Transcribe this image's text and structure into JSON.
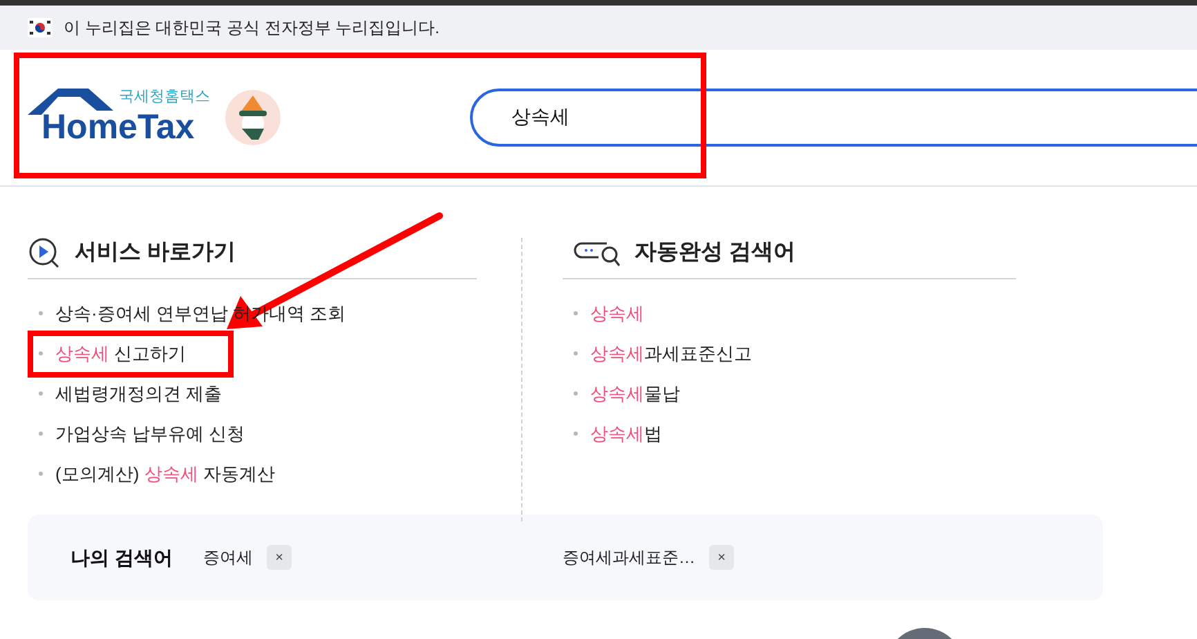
{
  "gov_banner": {
    "text": "이 누리집은 대한민국 공식 전자정부 누리집입니다."
  },
  "logo": {
    "subtitle": "국세청홈택스",
    "title": "HomeTax"
  },
  "search": {
    "value": "상속세"
  },
  "service_shortcuts": {
    "title": "서비스 바로가기",
    "items": [
      {
        "parts": [
          {
            "text": "상속·증여세 연부연납 허가내역 조회",
            "highlight": false
          }
        ]
      },
      {
        "parts": [
          {
            "text": "상속세",
            "highlight": true
          },
          {
            "text": " 신고하기",
            "highlight": false
          }
        ]
      },
      {
        "parts": [
          {
            "text": "세법령개정의견 제출",
            "highlight": false
          }
        ]
      },
      {
        "parts": [
          {
            "text": "가업상속 납부유예 신청",
            "highlight": false
          }
        ]
      },
      {
        "parts": [
          {
            "text": "(모의계산) ",
            "highlight": false
          },
          {
            "text": "상속세",
            "highlight": true
          },
          {
            "text": " 자동계산",
            "highlight": false
          }
        ]
      }
    ]
  },
  "autocomplete": {
    "title": "자동완성 검색어",
    "items": [
      {
        "parts": [
          {
            "text": "상속세",
            "highlight": true
          }
        ]
      },
      {
        "parts": [
          {
            "text": "상속세",
            "highlight": true
          },
          {
            "text": "과세표준신고",
            "highlight": false
          }
        ]
      },
      {
        "parts": [
          {
            "text": "상속세",
            "highlight": true
          },
          {
            "text": "물납",
            "highlight": false
          }
        ]
      },
      {
        "parts": [
          {
            "text": "상속세",
            "highlight": true
          },
          {
            "text": "법",
            "highlight": false
          }
        ]
      }
    ]
  },
  "my_searches": {
    "title": "나의 검색어",
    "items": [
      {
        "text": "증여세",
        "remove": "×"
      },
      {
        "text": "증여세과세표준…",
        "remove": "×"
      }
    ]
  }
}
